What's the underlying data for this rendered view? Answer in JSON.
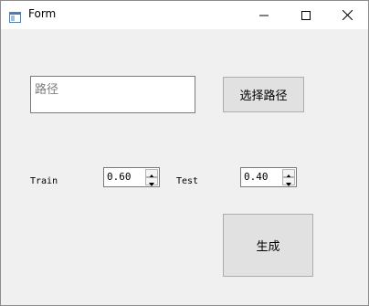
{
  "window": {
    "title": "Form"
  },
  "path_input": {
    "placeholder": "路径"
  },
  "buttons": {
    "select_path": "选择路径",
    "generate": "生成"
  },
  "split": {
    "train_label": "Train",
    "train_value": "0.60",
    "test_label": "Test",
    "test_value": "0.40"
  },
  "icons": {
    "app": "window-icon",
    "minimize": "minimize-icon",
    "maximize": "maximize-icon",
    "close": "close-icon",
    "spin_up": "arrow-up-icon",
    "spin_down": "arrow-down-icon"
  },
  "colors": {
    "window_bg": "#f0f0f0",
    "titlebar_bg": "#ffffff",
    "button_bg": "#e1e1e1",
    "button_border": "#adadad",
    "input_border": "#7a7a7a",
    "placeholder_text": "#7d7d7d"
  }
}
